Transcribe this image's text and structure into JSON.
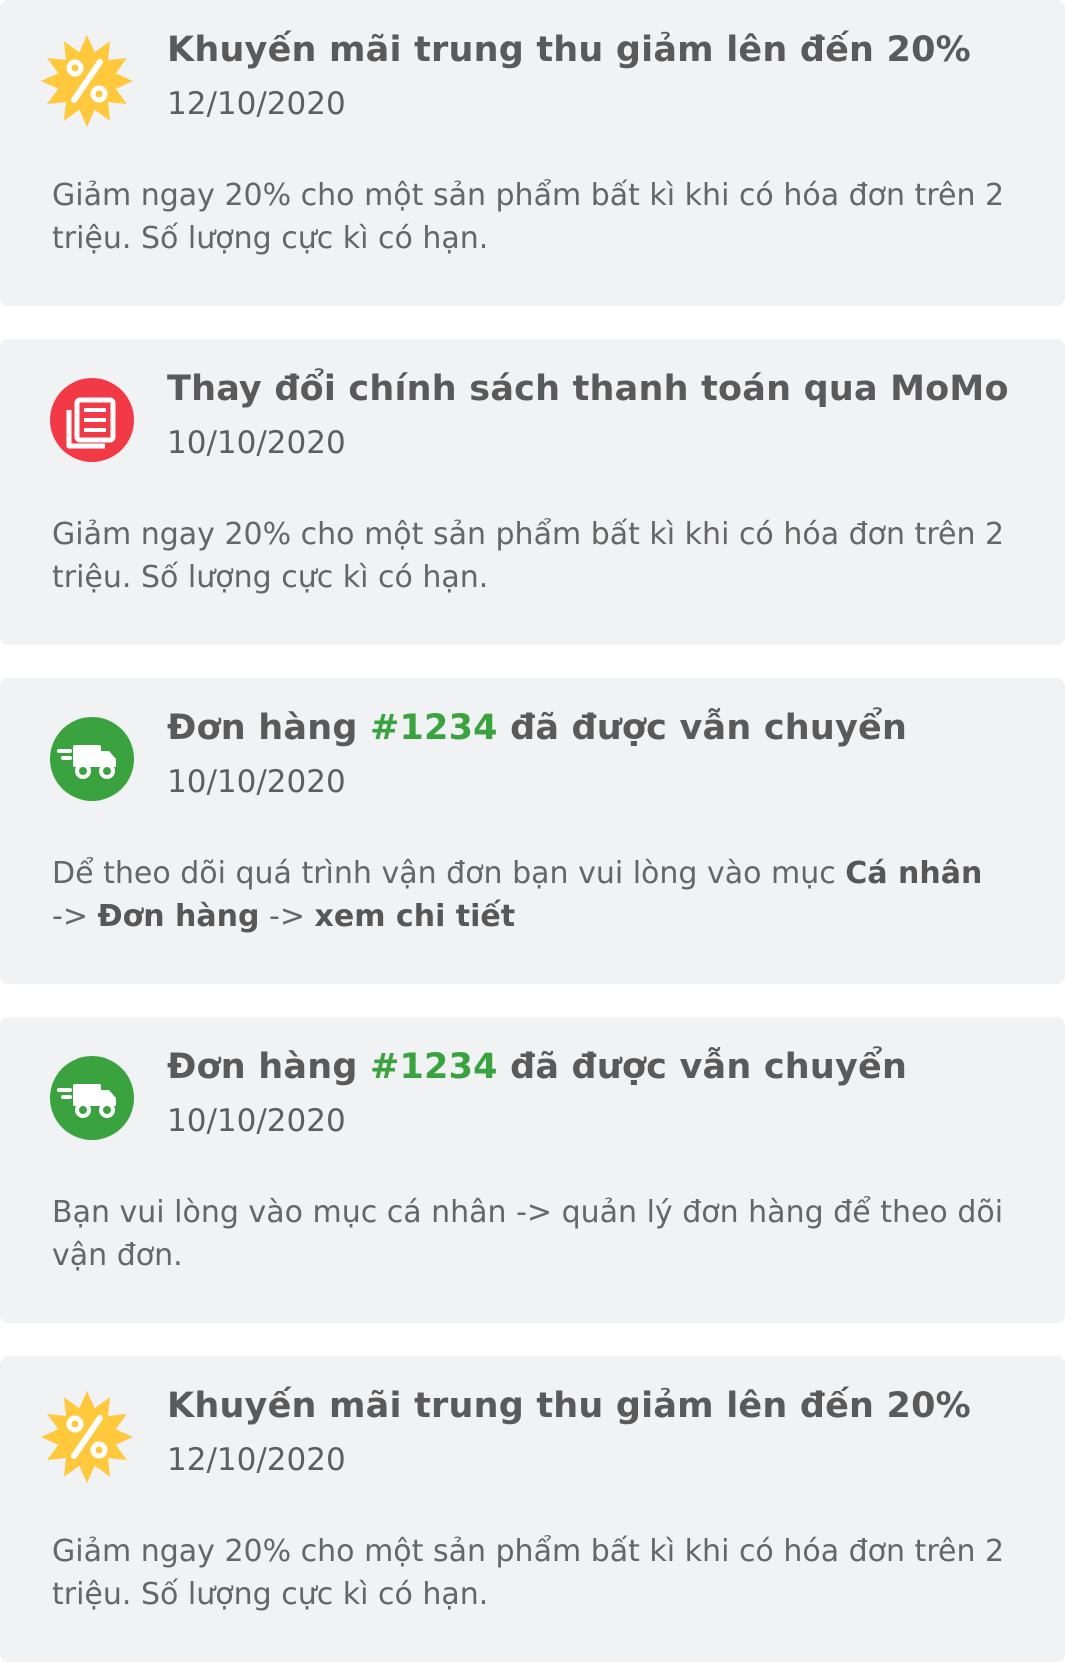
{
  "notifications": [
    {
      "icon": "percent-badge-icon",
      "icon_color": "#ffc83d",
      "title": "Khuyến mãi trung thu giảm lên đến 20%",
      "date": "12/10/2020",
      "body": "Giảm ngay 20% cho một sản phẩm bất kì khi có hóa đơn trên 2 triệu. Số lượng cực kì có hạn."
    },
    {
      "icon": "newspaper-icon",
      "icon_color": "#f23a47",
      "title": "Thay đổi chính sách thanh toán qua MoMo",
      "date": "10/10/2020",
      "body": "Giảm ngay 20% cho một sản phẩm bất kì khi có hóa đơn trên 2 triệu. Số lượng cực kì có hạn."
    },
    {
      "icon": "delivery-truck-icon",
      "icon_color": "#3aa23f",
      "title_prefix": "Đơn hàng ",
      "order_id": "#1234",
      "title_suffix": " đã được vẫn chuyển",
      "date": "10/10/2020",
      "body_intro": "Dể theo dõi quá trình vận đơn bạn vui lòng vào mục ",
      "body_step1": "Cá nhân",
      "body_arrow1": " -> ",
      "body_step2": "Đơn hàng",
      "body_arrow2": " -> ",
      "body_step3": "xem chi tiết"
    },
    {
      "icon": "delivery-truck-icon",
      "icon_color": "#3aa23f",
      "title_prefix": "Đơn hàng ",
      "order_id": "#1234",
      "title_suffix": " đã được vẫn chuyển",
      "date": "10/10/2020",
      "body": "Bạn vui lòng vào mục cá nhân -> quản lý đơn hàng để theo dõi vận đơn."
    },
    {
      "icon": "percent-badge-icon",
      "icon_color": "#ffc83d",
      "title": "Khuyến mãi trung thu giảm lên đến 20%",
      "date": "12/10/2020",
      "body": "Giảm ngay 20% cho một sản phẩm bất kì khi có hóa đơn trên 2 triệu. Số lượng cực kì có hạn."
    }
  ]
}
